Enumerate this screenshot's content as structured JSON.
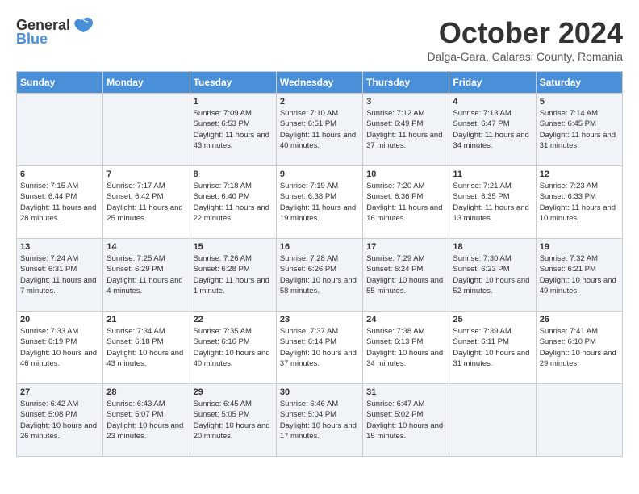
{
  "header": {
    "logo_general": "General",
    "logo_blue": "Blue",
    "month": "October 2024",
    "location": "Dalga-Gara, Calarasi County, Romania"
  },
  "days_of_week": [
    "Sunday",
    "Monday",
    "Tuesday",
    "Wednesday",
    "Thursday",
    "Friday",
    "Saturday"
  ],
  "weeks": [
    [
      {
        "day": "",
        "info": ""
      },
      {
        "day": "",
        "info": ""
      },
      {
        "day": "1",
        "info": "Sunrise: 7:09 AM\nSunset: 6:53 PM\nDaylight: 11 hours and 43 minutes."
      },
      {
        "day": "2",
        "info": "Sunrise: 7:10 AM\nSunset: 6:51 PM\nDaylight: 11 hours and 40 minutes."
      },
      {
        "day": "3",
        "info": "Sunrise: 7:12 AM\nSunset: 6:49 PM\nDaylight: 11 hours and 37 minutes."
      },
      {
        "day": "4",
        "info": "Sunrise: 7:13 AM\nSunset: 6:47 PM\nDaylight: 11 hours and 34 minutes."
      },
      {
        "day": "5",
        "info": "Sunrise: 7:14 AM\nSunset: 6:45 PM\nDaylight: 11 hours and 31 minutes."
      }
    ],
    [
      {
        "day": "6",
        "info": "Sunrise: 7:15 AM\nSunset: 6:44 PM\nDaylight: 11 hours and 28 minutes."
      },
      {
        "day": "7",
        "info": "Sunrise: 7:17 AM\nSunset: 6:42 PM\nDaylight: 11 hours and 25 minutes."
      },
      {
        "day": "8",
        "info": "Sunrise: 7:18 AM\nSunset: 6:40 PM\nDaylight: 11 hours and 22 minutes."
      },
      {
        "day": "9",
        "info": "Sunrise: 7:19 AM\nSunset: 6:38 PM\nDaylight: 11 hours and 19 minutes."
      },
      {
        "day": "10",
        "info": "Sunrise: 7:20 AM\nSunset: 6:36 PM\nDaylight: 11 hours and 16 minutes."
      },
      {
        "day": "11",
        "info": "Sunrise: 7:21 AM\nSunset: 6:35 PM\nDaylight: 11 hours and 13 minutes."
      },
      {
        "day": "12",
        "info": "Sunrise: 7:23 AM\nSunset: 6:33 PM\nDaylight: 11 hours and 10 minutes."
      }
    ],
    [
      {
        "day": "13",
        "info": "Sunrise: 7:24 AM\nSunset: 6:31 PM\nDaylight: 11 hours and 7 minutes."
      },
      {
        "day": "14",
        "info": "Sunrise: 7:25 AM\nSunset: 6:29 PM\nDaylight: 11 hours and 4 minutes."
      },
      {
        "day": "15",
        "info": "Sunrise: 7:26 AM\nSunset: 6:28 PM\nDaylight: 11 hours and 1 minute."
      },
      {
        "day": "16",
        "info": "Sunrise: 7:28 AM\nSunset: 6:26 PM\nDaylight: 10 hours and 58 minutes."
      },
      {
        "day": "17",
        "info": "Sunrise: 7:29 AM\nSunset: 6:24 PM\nDaylight: 10 hours and 55 minutes."
      },
      {
        "day": "18",
        "info": "Sunrise: 7:30 AM\nSunset: 6:23 PM\nDaylight: 10 hours and 52 minutes."
      },
      {
        "day": "19",
        "info": "Sunrise: 7:32 AM\nSunset: 6:21 PM\nDaylight: 10 hours and 49 minutes."
      }
    ],
    [
      {
        "day": "20",
        "info": "Sunrise: 7:33 AM\nSunset: 6:19 PM\nDaylight: 10 hours and 46 minutes."
      },
      {
        "day": "21",
        "info": "Sunrise: 7:34 AM\nSunset: 6:18 PM\nDaylight: 10 hours and 43 minutes."
      },
      {
        "day": "22",
        "info": "Sunrise: 7:35 AM\nSunset: 6:16 PM\nDaylight: 10 hours and 40 minutes."
      },
      {
        "day": "23",
        "info": "Sunrise: 7:37 AM\nSunset: 6:14 PM\nDaylight: 10 hours and 37 minutes."
      },
      {
        "day": "24",
        "info": "Sunrise: 7:38 AM\nSunset: 6:13 PM\nDaylight: 10 hours and 34 minutes."
      },
      {
        "day": "25",
        "info": "Sunrise: 7:39 AM\nSunset: 6:11 PM\nDaylight: 10 hours and 31 minutes."
      },
      {
        "day": "26",
        "info": "Sunrise: 7:41 AM\nSunset: 6:10 PM\nDaylight: 10 hours and 29 minutes."
      }
    ],
    [
      {
        "day": "27",
        "info": "Sunrise: 6:42 AM\nSunset: 5:08 PM\nDaylight: 10 hours and 26 minutes."
      },
      {
        "day": "28",
        "info": "Sunrise: 6:43 AM\nSunset: 5:07 PM\nDaylight: 10 hours and 23 minutes."
      },
      {
        "day": "29",
        "info": "Sunrise: 6:45 AM\nSunset: 5:05 PM\nDaylight: 10 hours and 20 minutes."
      },
      {
        "day": "30",
        "info": "Sunrise: 6:46 AM\nSunset: 5:04 PM\nDaylight: 10 hours and 17 minutes."
      },
      {
        "day": "31",
        "info": "Sunrise: 6:47 AM\nSunset: 5:02 PM\nDaylight: 10 hours and 15 minutes."
      },
      {
        "day": "",
        "info": ""
      },
      {
        "day": "",
        "info": ""
      }
    ]
  ]
}
